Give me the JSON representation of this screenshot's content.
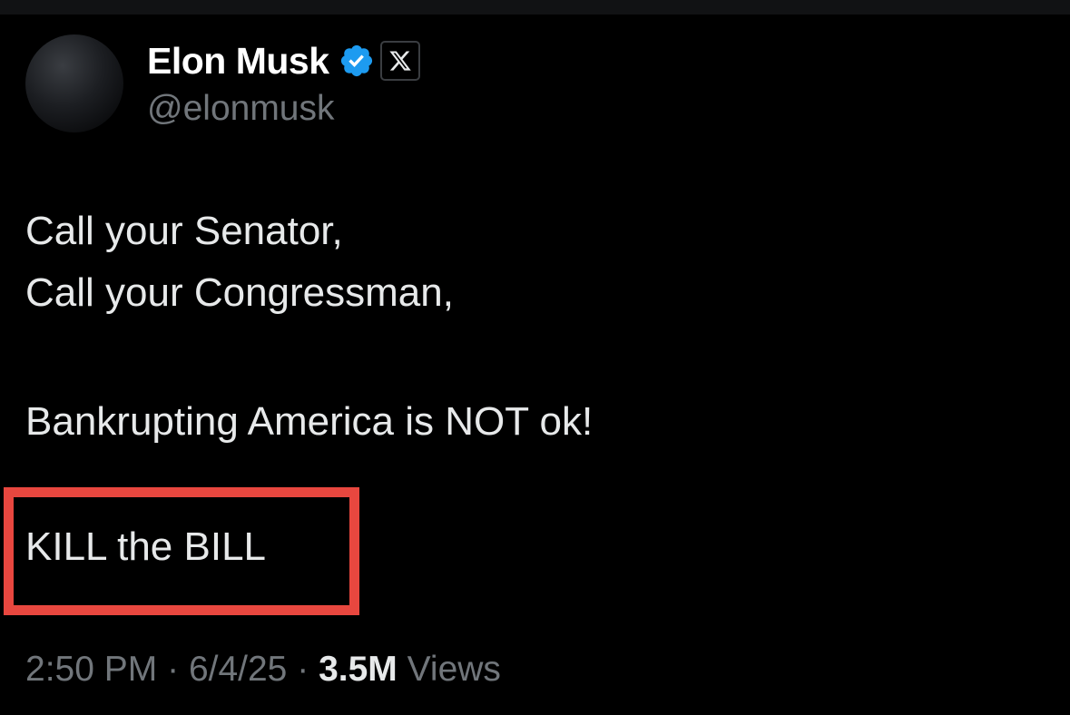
{
  "author": {
    "display_name": "Elon Musk",
    "handle": "@elonmusk",
    "verified_icon": "verified-badge-icon",
    "affiliate_icon": "x-logo-icon"
  },
  "tweet": {
    "lines": [
      "Call your Senator,",
      "Call your Congressman,",
      "Bankrupting America is NOT ok!",
      "KILL the BILL"
    ]
  },
  "meta": {
    "time": "2:50 PM",
    "separator": "·",
    "date": "6/4/25",
    "views_count": "3.5M",
    "views_label": "Views"
  },
  "colors": {
    "background": "#000000",
    "primary_text": "#e7e9ea",
    "secondary_text": "#71767b",
    "verified_blue": "#1d9bf0",
    "highlight_red": "#e8473f"
  }
}
